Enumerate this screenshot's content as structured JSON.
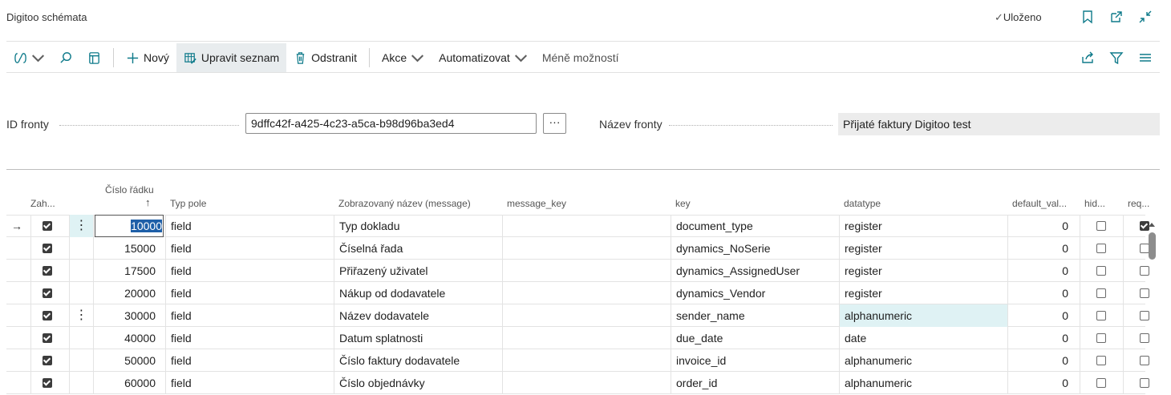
{
  "page": {
    "title": "Digitoo schémata",
    "saved_status": "Uloženo"
  },
  "toolbar": {
    "new_label": "Nový",
    "edit_list_label": "Upravit seznam",
    "delete_label": "Odstranit",
    "actions_label": "Akce",
    "automate_label": "Automatizovat",
    "fewer_options_label": "Méně možností"
  },
  "header": {
    "queue_id_label": "ID fronty",
    "queue_id_value": "9dffc42f-a425-4c23-a5ca-b98d96ba3ed4",
    "lookup_label": "···",
    "queue_name_label": "Název fronty",
    "queue_name_value": "Přijaté faktury Digitoo test"
  },
  "grid": {
    "columns": {
      "included": "Zah...",
      "line_no": "Číslo řádku",
      "sort_arrow": "↑",
      "field_type": "Typ pole",
      "display_name": "Zobrazovaný název (message)",
      "message_key": "message_key",
      "key": "key",
      "datatype": "datatype",
      "default_value": "default_val...",
      "hidden": "hid...",
      "required": "req..."
    },
    "current_row_marker": "→",
    "row_menu_glyph": "⋮",
    "rows": [
      {
        "included": true,
        "line_no": "10000",
        "field_type": "field",
        "display_name": "Typ dokladu",
        "message_key": "",
        "key": "document_type",
        "datatype": "register",
        "default_value": "0",
        "hidden": false,
        "required": true
      },
      {
        "included": true,
        "line_no": "15000",
        "field_type": "field",
        "display_name": "Číselná řada",
        "message_key": "",
        "key": "dynamics_NoSerie",
        "datatype": "register",
        "default_value": "0",
        "hidden": false,
        "required": false
      },
      {
        "included": true,
        "line_no": "17500",
        "field_type": "field",
        "display_name": "Přiřazený uživatel",
        "message_key": "",
        "key": "dynamics_AssignedUser",
        "datatype": "register",
        "default_value": "0",
        "hidden": false,
        "required": false
      },
      {
        "included": true,
        "line_no": "20000",
        "field_type": "field",
        "display_name": "Nákup od dodavatele",
        "message_key": "",
        "key": "dynamics_Vendor",
        "datatype": "register",
        "default_value": "0",
        "hidden": false,
        "required": false
      },
      {
        "included": true,
        "line_no": "30000",
        "field_type": "field",
        "display_name": "Název dodavatele",
        "message_key": "",
        "key": "sender_name",
        "datatype": "alphanumeric",
        "default_value": "0",
        "hidden": false,
        "required": false
      },
      {
        "included": true,
        "line_no": "40000",
        "field_type": "field",
        "display_name": "Datum splatnosti",
        "message_key": "",
        "key": "due_date",
        "datatype": "date",
        "default_value": "0",
        "hidden": false,
        "required": false
      },
      {
        "included": true,
        "line_no": "50000",
        "field_type": "field",
        "display_name": "Číslo faktury dodavatele",
        "message_key": "",
        "key": "invoice_id",
        "datatype": "alphanumeric",
        "default_value": "0",
        "hidden": false,
        "required": false
      },
      {
        "included": true,
        "line_no": "60000",
        "field_type": "field",
        "display_name": "Číslo objednávky",
        "message_key": "",
        "key": "order_id",
        "datatype": "alphanumeric",
        "default_value": "0",
        "hidden": false,
        "required": false
      }
    ]
  },
  "icons": {
    "copilot": "copilot-icon",
    "search": "search-icon",
    "filter_pane": "filter-pane-icon",
    "bookmark": "bookmark-icon",
    "open_new": "open-in-new-window-icon",
    "collapse": "collapse-icon",
    "share": "share-icon",
    "filter": "filter-icon",
    "list_view": "list-view-icon"
  },
  "colors": {
    "accent": "#0e7a8a",
    "selection": "#dff2f4"
  }
}
